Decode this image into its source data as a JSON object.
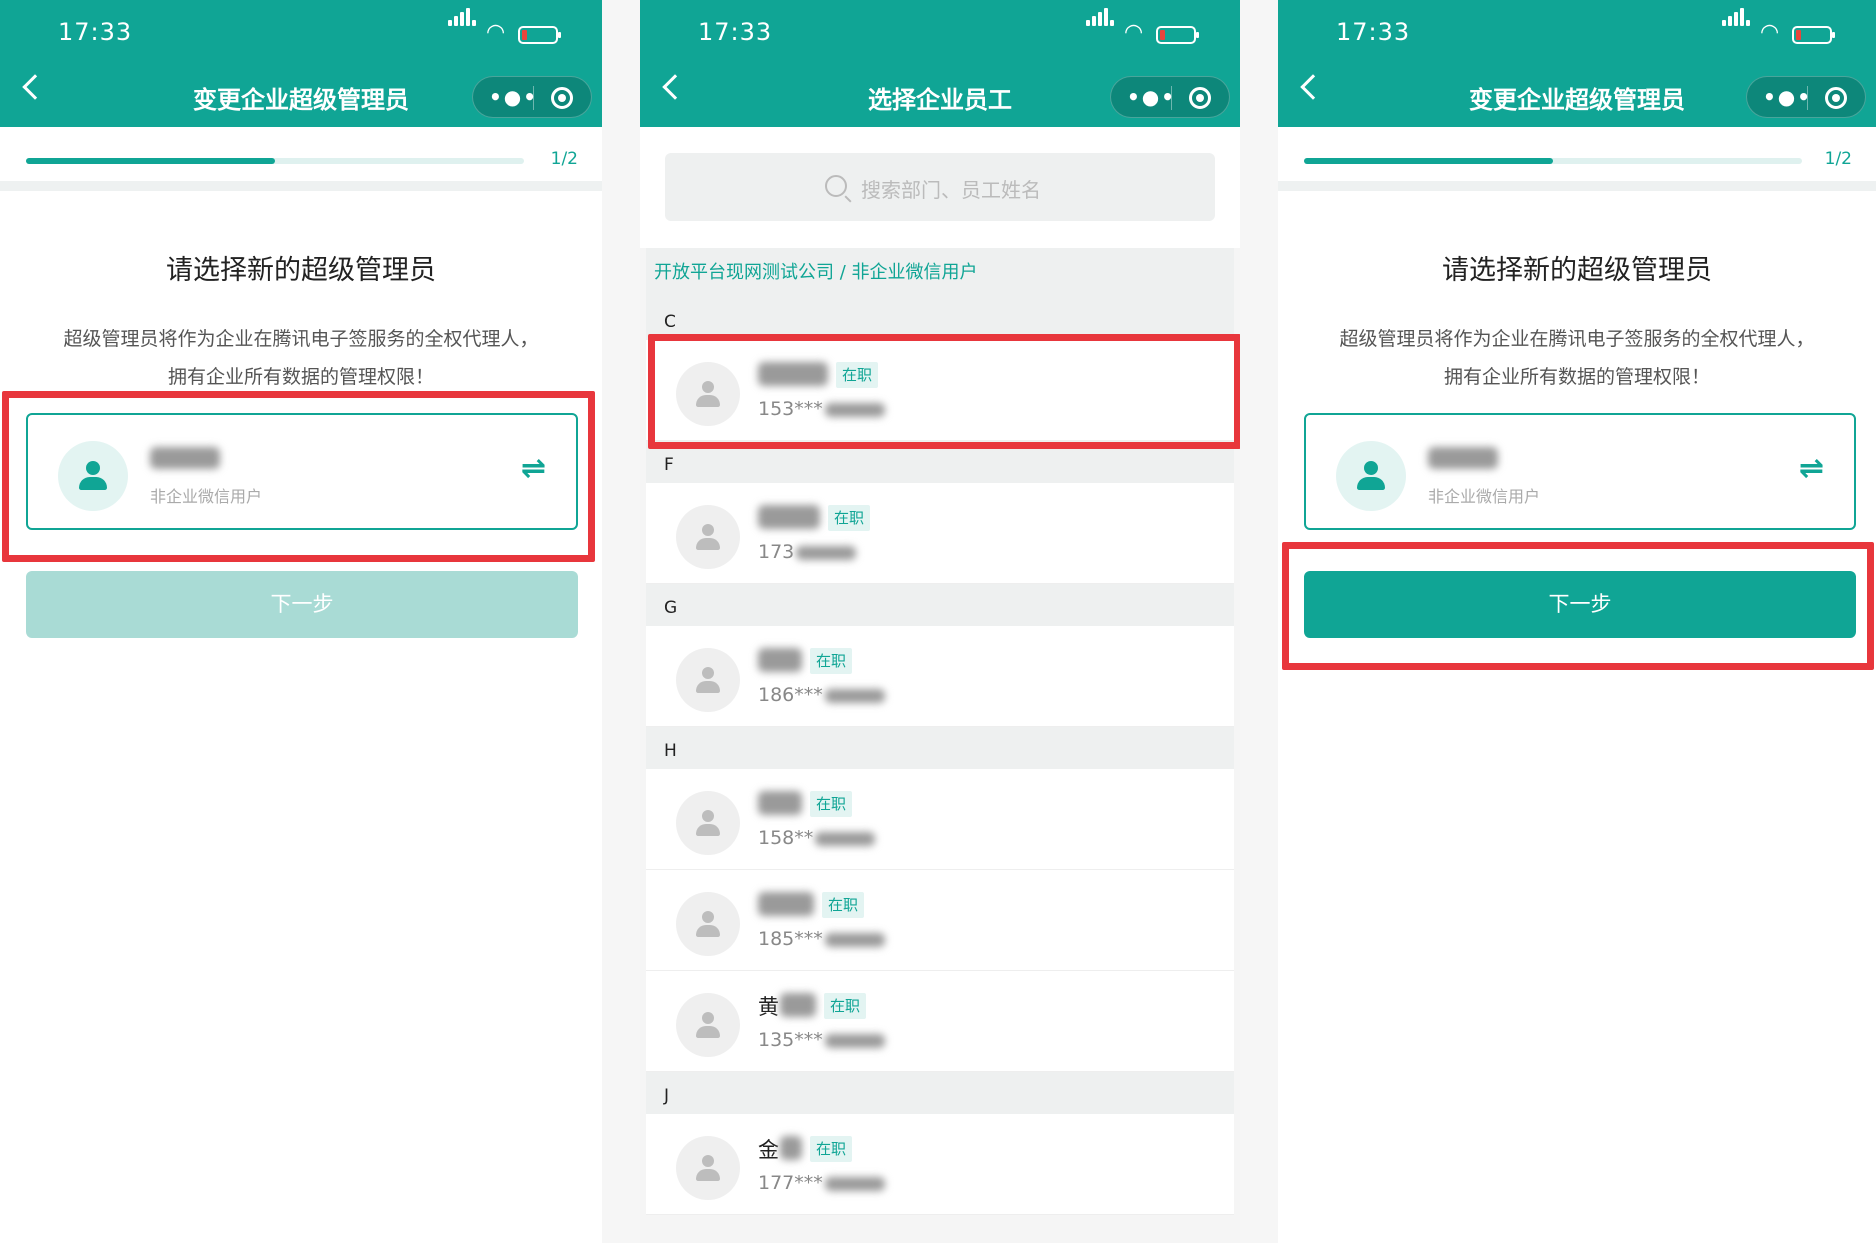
{
  "status_bar": {
    "time": "17:33"
  },
  "screen1": {
    "title": "变更企业超级管理员",
    "progress": {
      "label": "1/2",
      "fraction": 0.5
    },
    "heading": "请选择新的超级管理员",
    "description_line1": "超级管理员将作为企业在腾讯电子签服务的全权代理人，",
    "description_line2": "拥有企业所有数据的管理权限！",
    "selected_user": {
      "subtitle": "非企业微信用户"
    },
    "next_button": {
      "label": "下一步",
      "enabled": false
    }
  },
  "screen2": {
    "title": "选择企业员工",
    "search_placeholder": "搜索部门、员工姓名",
    "breadcrumb": "开放平台现网测试公司 / 非企业微信用户",
    "groups": [
      {
        "letter": "C",
        "employees": [
          {
            "name_initial": "",
            "status": "在职",
            "phone_prefix": "153***"
          }
        ]
      },
      {
        "letter": "F",
        "employees": [
          {
            "name_initial": "",
            "status": "在职",
            "phone_prefix": "173"
          }
        ]
      },
      {
        "letter": "G",
        "employees": [
          {
            "name_initial": "",
            "status": "在职",
            "phone_prefix": "186***"
          }
        ]
      },
      {
        "letter": "H",
        "employees": [
          {
            "name_initial": "",
            "status": "在职",
            "phone_prefix": "158**"
          },
          {
            "name_initial": "",
            "status": "在职",
            "phone_prefix": "185***"
          },
          {
            "name_initial": "黄",
            "status": "在职",
            "phone_prefix": "135***"
          }
        ]
      },
      {
        "letter": "J",
        "employees": [
          {
            "name_initial": "金",
            "status": "在职",
            "phone_prefix": "177***"
          }
        ]
      }
    ]
  },
  "screen3": {
    "title": "变更企业超级管理员",
    "progress": {
      "label": "1/2",
      "fraction": 0.5
    },
    "heading": "请选择新的超级管理员",
    "description_line1": "超级管理员将作为企业在腾讯电子签服务的全权代理人，",
    "description_line2": "拥有企业所有数据的管理权限！",
    "selected_user": {
      "subtitle": "非企业微信用户"
    },
    "next_button": {
      "label": "下一步",
      "enabled": true
    }
  },
  "colors": {
    "brand": "#10a595",
    "highlight": "#e8363c",
    "disabled_button": "#a9dbd5"
  },
  "icons": [
    "back-icon",
    "more-icon",
    "target-icon",
    "search-icon",
    "person-icon",
    "swap-icon",
    "signal-icon",
    "wifi-icon",
    "battery-icon"
  ]
}
